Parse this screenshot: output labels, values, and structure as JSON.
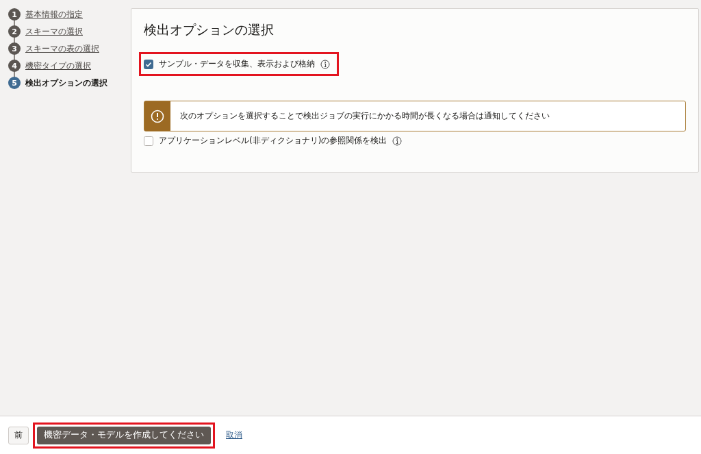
{
  "steps": [
    {
      "number": "1",
      "label": "基本情報の指定",
      "selected": false
    },
    {
      "number": "2",
      "label": "スキーマの選択",
      "selected": false
    },
    {
      "number": "3",
      "label": "スキーマの表の選択",
      "selected": false
    },
    {
      "number": "4",
      "label": "機密タイプの選択",
      "selected": false
    },
    {
      "number": "5",
      "label": "検出オプションの選択",
      "selected": true
    }
  ],
  "panel": {
    "title": "検出オプションの選択",
    "sample_option": {
      "label": "サンプル・データを収集、表示および格納",
      "checked": true,
      "highlighted": true
    },
    "warning": {
      "text": "次のオプションを選択することで検出ジョブの実行にかかる時間が長くなる場合は通知してください"
    },
    "reference_option": {
      "label": "アプリケーションレベル(非ディクショナリ)の参照関係を検出",
      "checked": false
    }
  },
  "footer": {
    "back_button": "前",
    "create_button": {
      "label": "機密データ・モデルを作成してください",
      "highlighted": true
    },
    "cancel_link": "取消"
  }
}
